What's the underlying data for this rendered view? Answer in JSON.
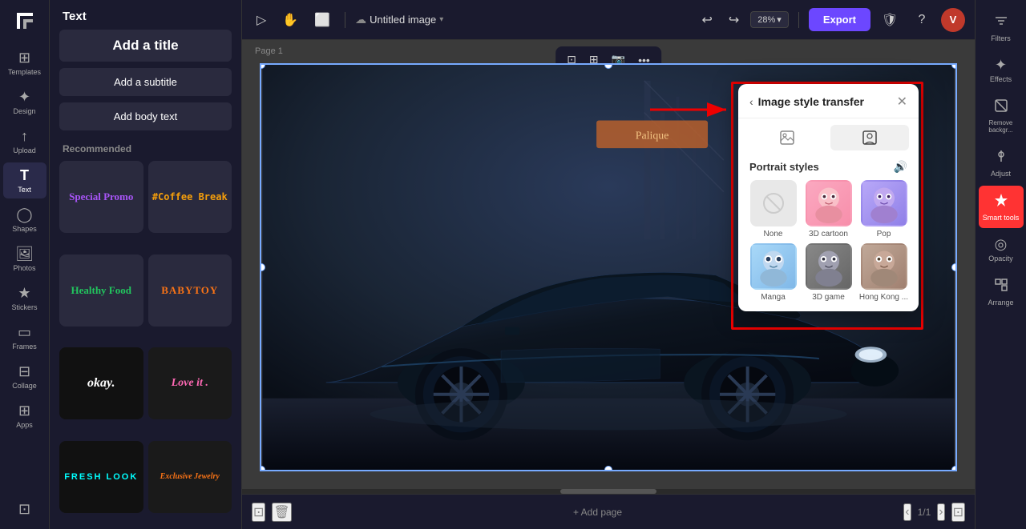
{
  "app": {
    "logo": "✕",
    "title": "Untitled image",
    "title_icon": "▾",
    "user_initial": "V"
  },
  "topbar": {
    "cursor_tool": "▷",
    "hand_tool": "✋",
    "frame_tool": "⬜",
    "zoom": "28%",
    "zoom_icon": "▾",
    "undo": "↩",
    "redo": "↪",
    "export_label": "Export",
    "shield_icon": "🛡",
    "help_icon": "?"
  },
  "left_sidebar": {
    "items": [
      {
        "icon": "⊞",
        "label": "Templates"
      },
      {
        "icon": "✦",
        "label": "Design"
      },
      {
        "icon": "↑",
        "label": "Upload"
      },
      {
        "icon": "T",
        "label": "Text"
      },
      {
        "icon": "◯",
        "label": "Shapes"
      },
      {
        "icon": "🖼",
        "label": "Photos"
      },
      {
        "icon": "★",
        "label": "Stickers"
      },
      {
        "icon": "▭",
        "label": "Frames"
      },
      {
        "icon": "⊟",
        "label": "Collage"
      },
      {
        "icon": "⊞",
        "label": "Apps"
      }
    ]
  },
  "panel": {
    "title": "Text",
    "add_title": "Add a title",
    "add_subtitle": "Add a subtitle",
    "add_body": "Add body text",
    "recommended_label": "Recommended",
    "styles": [
      {
        "label": "Special Promo",
        "color": "#a855f7",
        "font": "cursive",
        "size": "14px",
        "bg": "#2a2a3e"
      },
      {
        "label": "#Coffee Break",
        "color": "#f59e0b",
        "font": "monospace",
        "size": "13px",
        "bg": "#2a2a3e"
      },
      {
        "label": "Healthy Food",
        "color": "#22c55e",
        "font": "serif",
        "size": "13px",
        "bg": "#2a2a3e"
      },
      {
        "label": "BABYTOY",
        "color": "#f97316",
        "font": "serif",
        "size": "14px",
        "bg": "#2a2a3e"
      },
      {
        "label": "okay.",
        "color": "#fff",
        "font": "cursive",
        "size": "16px",
        "bg": "#111"
      },
      {
        "label": "Love it .",
        "color": "#ff69b4",
        "font": "cursive",
        "size": "14px",
        "bg": "#222"
      },
      {
        "label": "FRESH LOOK",
        "color": "#0ff",
        "font": "sans-serif",
        "size": "11px",
        "bg": "#111"
      },
      {
        "label": "Exclusive Jewelry",
        "color": "#f97316",
        "font": "serif",
        "size": "11px",
        "bg": "#222"
      }
    ]
  },
  "canvas": {
    "page_label": "Page 1",
    "add_page": "Add page",
    "page_num": "1/1"
  },
  "right_sidebar": {
    "items": [
      {
        "icon": "≡≡",
        "label": "Filters"
      },
      {
        "icon": "✦",
        "label": "Effects"
      },
      {
        "icon": "⌫",
        "label": "Remove backgr..."
      },
      {
        "icon": "◈",
        "label": "Adjust"
      },
      {
        "icon": "⚙",
        "label": "Smart tools",
        "active": true
      },
      {
        "icon": "◎",
        "label": "Opacity"
      },
      {
        "icon": "⊞",
        "label": "Arrange"
      }
    ]
  },
  "popup": {
    "title": "Image style transfer",
    "back_icon": "‹",
    "close_icon": "✕",
    "tab1_icon": "🖼",
    "tab2_icon": "👤",
    "section_title": "Portrait styles",
    "volume_icon": "🔊",
    "styles": [
      {
        "id": "none",
        "label": "None",
        "type": "none",
        "selected": false
      },
      {
        "id": "3d-cartoon",
        "label": "3D cartoon",
        "type": "cartoon",
        "selected": false
      },
      {
        "id": "pop",
        "label": "Pop",
        "type": "pop",
        "selected": false
      },
      {
        "id": "manga",
        "label": "Manga",
        "type": "manga",
        "selected": false
      },
      {
        "id": "3d-game",
        "label": "3D game",
        "type": "3dgame",
        "selected": false
      },
      {
        "id": "hong-kong",
        "label": "Hong Kong ...",
        "type": "hk",
        "selected": false
      }
    ]
  }
}
